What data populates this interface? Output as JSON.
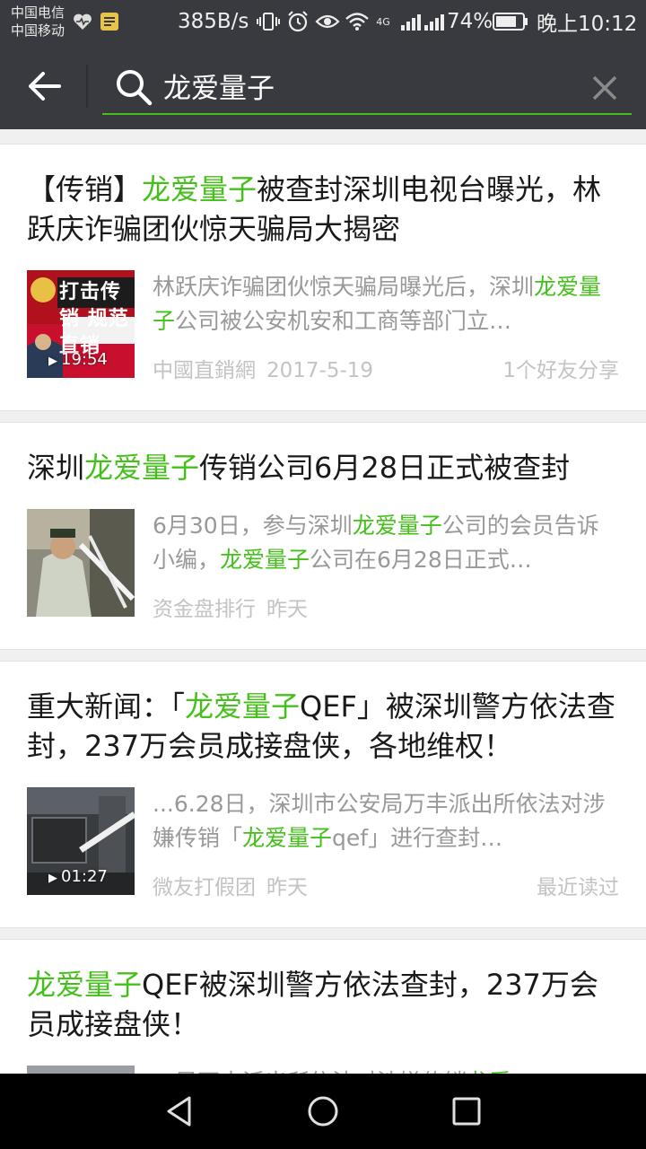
{
  "status_bar": {
    "carrier1": "中国电信",
    "carrier2": "中国移动",
    "speed": "385B/s",
    "battery_pct": "74%",
    "time": "晚上10:12",
    "network": "4G",
    "icons": [
      "heart-rate-icon",
      "notes-app-icon",
      "vibrate-icon",
      "alarm-icon",
      "eye-icon",
      "wifi-icon",
      "signal-icon",
      "battery-icon"
    ]
  },
  "search": {
    "query": "龙爱量子",
    "accent_color": "#45c01a"
  },
  "results": [
    {
      "title": [
        {
          "text": "【传销】"
        },
        {
          "text": "龙爱量子",
          "hl": true
        },
        {
          "text": "被查封深圳电视台曝光，林跃庆诈骗团伙惊天骗局大揭密"
        }
      ],
      "snippet": [
        {
          "text": "林跃庆诈骗团伙惊天骗局曝光后，深圳"
        },
        {
          "text": "龙爱量子",
          "hl": true
        },
        {
          "text": "公司被公安机安和工商等部门立…"
        }
      ],
      "source": "中國直銷網",
      "date": "2017-5-19",
      "right_note": "1个好友分享",
      "duration": "19:54",
      "thumb": "thumb-1",
      "thumb_text": "打击传销 规范直销"
    },
    {
      "title": [
        {
          "text": "深圳"
        },
        {
          "text": "龙爱量子",
          "hl": true
        },
        {
          "text": "传销公司6月28日正式被查封"
        }
      ],
      "snippet": [
        {
          "text": "6月30日，参与深圳"
        },
        {
          "text": "龙爱量子",
          "hl": true
        },
        {
          "text": "公司的会员告诉小编，"
        },
        {
          "text": "龙爱量子",
          "hl": true
        },
        {
          "text": "公司在6月28日正式…"
        }
      ],
      "source": "资金盘排行",
      "date": "昨天",
      "right_note": "",
      "duration": "",
      "thumb": "thumb-2",
      "thumb_text": ""
    },
    {
      "title": [
        {
          "text": "重大新闻：「"
        },
        {
          "text": "龙爱量子",
          "hl": true
        },
        {
          "text": "QEF」被深圳警方依法查封，237万会员成接盘侠，各地维权！"
        }
      ],
      "snippet": [
        {
          "text": "...6.28日，深圳市公安局万丰派出所依法对涉嫌传销「"
        },
        {
          "text": "龙爱量子",
          "hl": true
        },
        {
          "text": "qef」进行查封…"
        }
      ],
      "source": "微友打假团",
      "date": "昨天",
      "right_note": "最近读过",
      "duration": "01:27",
      "thumb": "thumb-3",
      "thumb_text": ""
    },
    {
      "title": [
        {
          "text": "龙爱量子",
          "hl": true
        },
        {
          "text": "QEF被深圳警方依法查封，237万会员成接盘侠！"
        }
      ],
      "snippet": [
        {
          "text": "…局万丰派出所依法对涉嫌传销"
        },
        {
          "text": "龙爱",
          "hl": true
        }
      ],
      "source": "",
      "date": "",
      "right_note": "",
      "duration": "",
      "thumb": "thumb-4",
      "thumb_text": ""
    }
  ],
  "nav": {
    "icons": [
      "back-triangle-icon",
      "home-circle-icon",
      "recents-square-icon"
    ]
  }
}
